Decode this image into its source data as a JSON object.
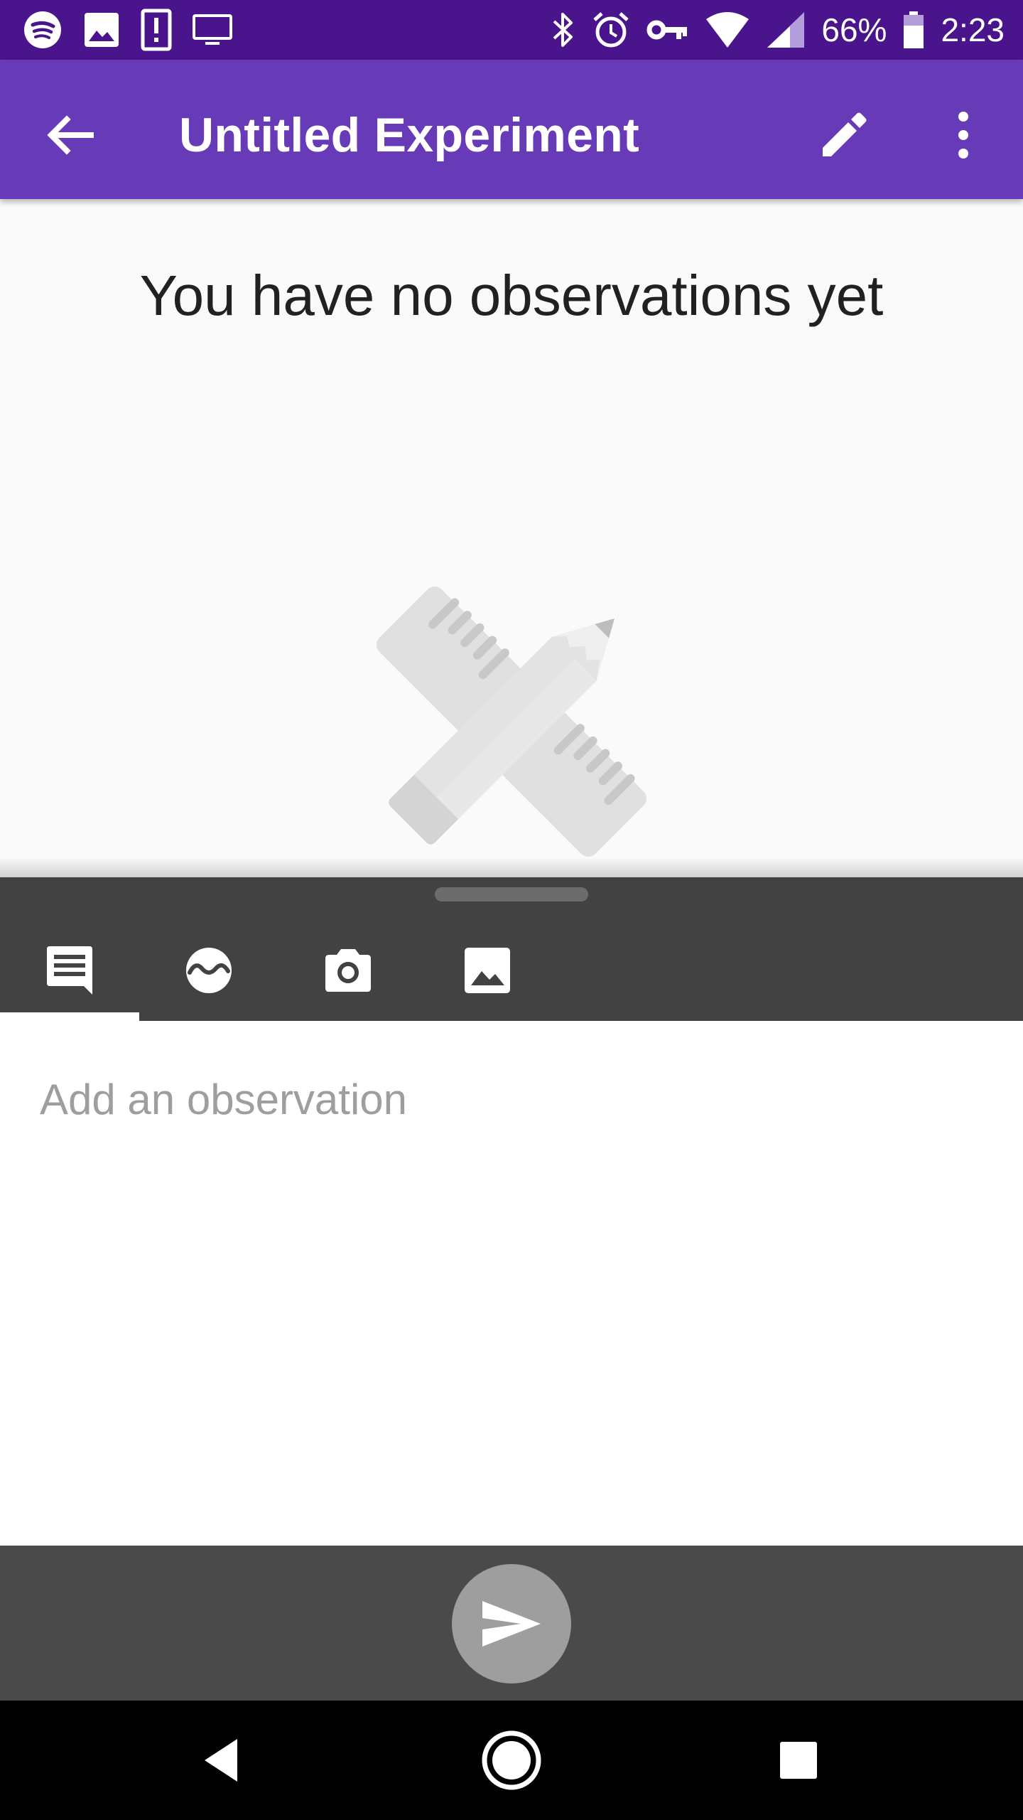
{
  "status_bar": {
    "left_icons": [
      "spotify-icon",
      "image-notification-icon",
      "alert-notification-icon",
      "cast-display-icon"
    ],
    "right_icons": [
      "bluetooth-icon",
      "alarm-icon",
      "vpn-key-icon",
      "wifi-icon",
      "cell-signal-icon",
      "battery-icon"
    ],
    "battery_text": "66%",
    "time": "2:23"
  },
  "app_bar": {
    "title": "Untitled Experiment",
    "actions": [
      "edit-icon",
      "more-vert-icon"
    ]
  },
  "empty_state": {
    "message": "You have no observations yet",
    "illustration": "ruler-pencil-illustration"
  },
  "input_toolbar": {
    "tabs": [
      "text-note-icon",
      "sensor-wave-icon",
      "camera-icon",
      "gallery-icon"
    ],
    "selected_tab": 0
  },
  "note_input": {
    "placeholder": "Add an observation",
    "value": ""
  },
  "send": {
    "icon": "send-icon"
  },
  "nav_bar": {
    "buttons": [
      "back-icon",
      "home-icon",
      "recents-icon"
    ]
  },
  "colors": {
    "status_bar": "#4a148c",
    "app_bar": "#673ab7",
    "toolbar": "#424242",
    "send_bar": "#4a4a4a",
    "send_button": "#9e9e9e"
  }
}
